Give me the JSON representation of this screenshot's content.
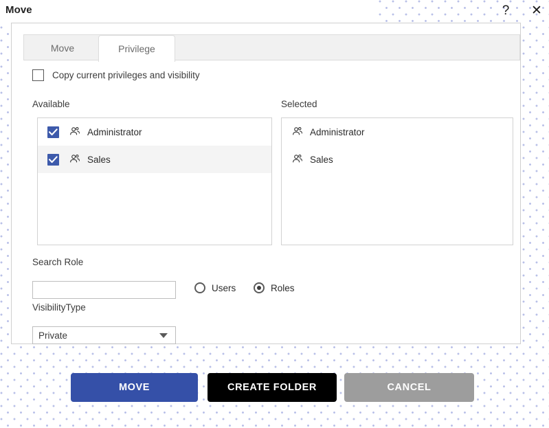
{
  "window": {
    "title": "Move",
    "help_icon": "question-mark-icon",
    "help_glyph": "?",
    "close_icon": "close-icon",
    "close_glyph": "✕"
  },
  "tabs": [
    {
      "label": "Move",
      "active": false
    },
    {
      "label": "Privilege",
      "active": true
    }
  ],
  "form": {
    "copy_privileges": {
      "label": "Copy current privileges and visibility",
      "checked": false
    },
    "available": {
      "label": "Available",
      "items": [
        {
          "label": "Administrator",
          "checked": true,
          "highlighted": false,
          "icon": "group-icon"
        },
        {
          "label": "Sales",
          "checked": true,
          "highlighted": true,
          "icon": "group-icon"
        }
      ]
    },
    "selected": {
      "label": "Selected",
      "items": [
        {
          "label": "Administrator",
          "icon": "group-icon"
        },
        {
          "label": "Sales",
          "icon": "group-icon"
        }
      ]
    },
    "search_role": {
      "label": "Search Role",
      "value": "",
      "placeholder": ""
    },
    "scope_radios": [
      {
        "label": "Users",
        "selected": false
      },
      {
        "label": "Roles",
        "selected": true
      }
    ],
    "visibility_type": {
      "label": "VisibilityType",
      "value": "Private",
      "caret_icon": "chevron-down-icon"
    }
  },
  "footer": {
    "move_label": "MOVE",
    "create_folder_label": "CREATE FOLDER",
    "cancel_label": "CANCEL"
  },
  "colors": {
    "primary_blue": "#3550a8",
    "checkbox_blue": "#3d5aab",
    "cancel_gray": "#9d9d9d",
    "create_black": "#000000",
    "dot_pattern": "#b9c0e8"
  }
}
